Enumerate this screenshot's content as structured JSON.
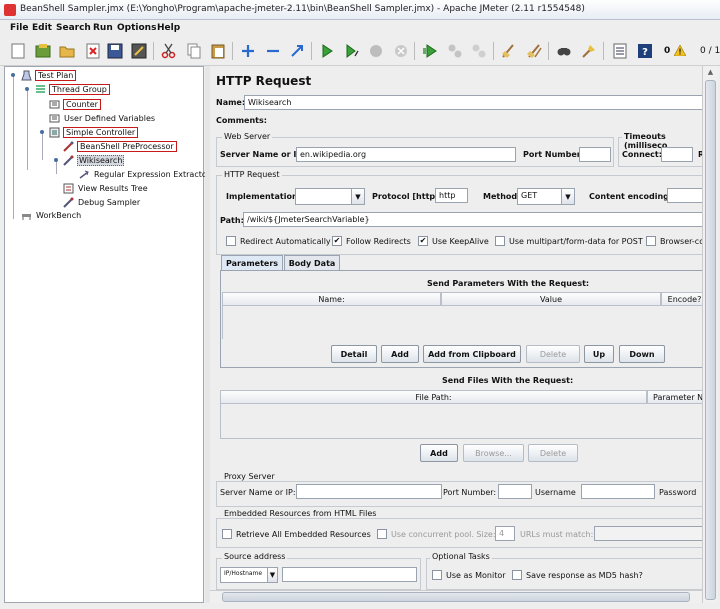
{
  "window": {
    "title": "BeanShell Sampler.jmx (E:\\Yongho\\Program\\apache-jmeter-2.11\\bin\\BeanShell Sampler.jmx) - Apache JMeter (2.11 r1554548)"
  },
  "menu": [
    {
      "label": "File"
    },
    {
      "label": "Edit"
    },
    {
      "label": "Search"
    },
    {
      "label": "Run"
    },
    {
      "label": "Options"
    },
    {
      "label": "Help"
    }
  ],
  "toolbar": {
    "warning_count": "0",
    "threads": "0 / 1"
  },
  "tree": {
    "test_plan": "Test Plan",
    "thread_group": "Thread Group",
    "counter": "Counter",
    "user_defined_variables": "User Defined Variables",
    "simple_controller": "Simple Controller",
    "beanshell_preprocessor": "BeanShell PreProcessor",
    "wikisearch": "Wikisearch",
    "regex_extractor": "Regular Expression Extractor",
    "view_results_tree": "View Results Tree",
    "debug_sampler": "Debug Sampler",
    "workbench": "WorkBench"
  },
  "panel": {
    "title": "HTTP Request",
    "name_label": "Name:",
    "name_value": "Wikisearch",
    "comments_label": "Comments:",
    "web_server": {
      "group_title": "Web Server",
      "server_label": "Server Name or IP:",
      "server_value": "en.wikipedia.org",
      "port_label": "Port Number:",
      "timeouts_title": "Timeouts (milliseco",
      "connect_label": "Connect:",
      "response_label": "R"
    },
    "http_request": {
      "group_title": "HTTP Request",
      "implementation_label": "Implementation:",
      "protocol_label": "Protocol [http]:",
      "protocol_value": "http",
      "method_label": "Method:",
      "method_value": "GET",
      "encoding_label": "Content encoding:",
      "path_label": "Path:",
      "path_value": "/wiki/${JmeterSearchVariable}",
      "options": [
        {
          "label": "Redirect Automatically",
          "checked": false
        },
        {
          "label": "Follow Redirects",
          "checked": true
        },
        {
          "label": "Use KeepAlive",
          "checked": true
        },
        {
          "label": "Use multipart/form-data for POST",
          "checked": false
        },
        {
          "label": "Browser-co",
          "checked": false
        }
      ]
    },
    "tabs": [
      {
        "label": "Parameters"
      },
      {
        "label": "Body Data"
      }
    ],
    "params": {
      "title": "Send Parameters With the Request:",
      "columns": [
        "Name:",
        "Value",
        "Encode?"
      ],
      "buttons": [
        "Detail",
        "Add",
        "Add from Clipboard",
        "Delete",
        "Up",
        "Down"
      ]
    },
    "files": {
      "title": "Send Files With the Request:",
      "columns": [
        "File Path:",
        "Parameter N"
      ],
      "buttons": [
        "Add",
        "Browse...",
        "Delete"
      ]
    },
    "proxy": {
      "group_title": "Proxy Server",
      "server_label": "Server Name or IP:",
      "port_label": "Port Number:",
      "username_label": "Username",
      "password_label": "Password"
    },
    "embedded": {
      "group_title": "Embedded Resources from HTML Files",
      "retrieve_label": "Retrieve All Embedded Resources",
      "concurrent_label": "Use concurrent pool. Size:",
      "pool_size": "4",
      "urls_label": "URLs must match:"
    },
    "source": {
      "group_title": "Source address",
      "type_value": "IP/Hostname"
    },
    "optional": {
      "group_title": "Optional Tasks",
      "monitor_label": "Use as Monitor",
      "md5_label": "Save response as MD5 hash?"
    }
  }
}
